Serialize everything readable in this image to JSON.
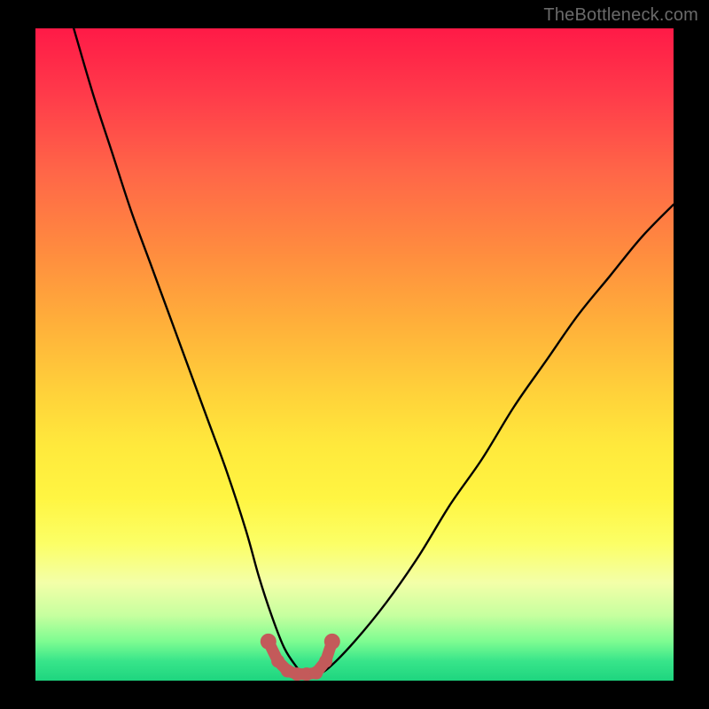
{
  "watermark": "TheBottleneck.com",
  "colors": {
    "page_bg": "#000000",
    "gradient_top": "#ff1a47",
    "gradient_mid": "#ffe93c",
    "gradient_bottom": "#1ed57f",
    "curve": "#000000",
    "marker": "#c35a5a",
    "marker_stroke": "#a84545"
  },
  "chart_data": {
    "type": "line",
    "title": "",
    "xlabel": "",
    "ylabel": "",
    "xlim": [
      0,
      100
    ],
    "ylim": [
      0,
      100
    ],
    "series": [
      {
        "name": "bottleneck-curve",
        "x": [
          6,
          9,
          12,
          15,
          18,
          21,
          24,
          27,
          30,
          33,
          35,
          37,
          39,
          41,
          42,
          44,
          46,
          50,
          55,
          60,
          65,
          70,
          75,
          80,
          85,
          90,
          95,
          100
        ],
        "values": [
          100,
          90,
          81,
          72,
          64,
          56,
          48,
          40,
          32,
          23,
          16,
          10,
          5,
          2,
          1,
          1,
          2,
          6,
          12,
          19,
          27,
          34,
          42,
          49,
          56,
          62,
          68,
          73
        ]
      }
    ],
    "markers": {
      "name": "trough-markers",
      "x": [
        36.5,
        38.0,
        39.5,
        41.0,
        42.5,
        44.0,
        45.5,
        46.5
      ],
      "values": [
        6.0,
        3.0,
        1.5,
        1.0,
        1.0,
        1.2,
        3.0,
        6.0
      ]
    }
  }
}
